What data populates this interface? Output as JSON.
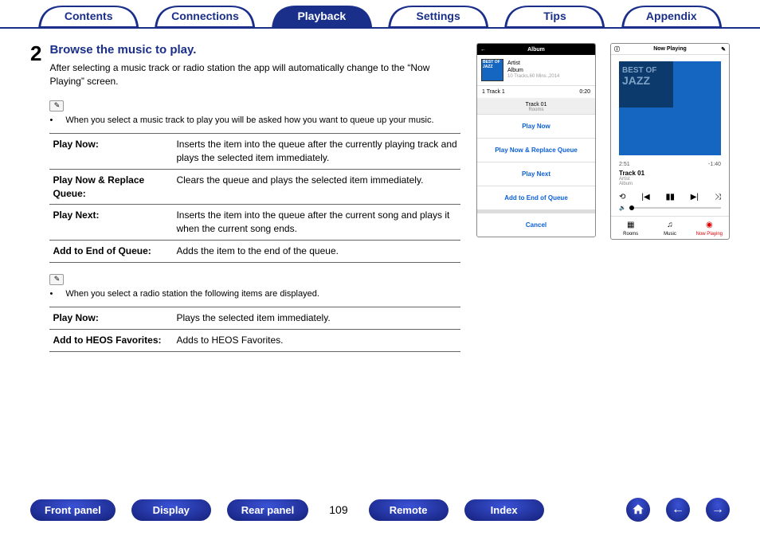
{
  "tabs": {
    "contents": "Contents",
    "connections": "Connections",
    "playback": "Playback",
    "settings": "Settings",
    "tips": "Tips",
    "appendix": "Appendix"
  },
  "step": {
    "num": "2",
    "title": "Browse the music to play.",
    "desc": "After selecting a music track or radio station the app will automatically change to the “Now Playing” screen."
  },
  "note1": "When you select a music track to play you will be asked how you want to queue up your music.",
  "table1": [
    {
      "term": "Play Now:",
      "desc": "Inserts the item into the queue after the currently playing track and plays the selected item immediately."
    },
    {
      "term": "Play Now & Replace Queue:",
      "desc": "Clears the queue and plays the selected item immediately."
    },
    {
      "term": "Play Next:",
      "desc": "Inserts the item into the queue after the current song and plays it when the current song ends."
    },
    {
      "term": "Add to End of Queue:",
      "desc": "Adds the item to the end of the queue."
    }
  ],
  "note2": "When you select a radio station the following items are displayed.",
  "table2": [
    {
      "term": "Play Now:",
      "desc": "Plays the selected item immediately."
    },
    {
      "term": "Add to HEOS Favorites:",
      "desc": "Adds to HEOS Favorites."
    }
  ],
  "phone1": {
    "bar_title": "Album",
    "back": "←",
    "thumb": "BEST OF\nJAZZ",
    "artist": "Artist",
    "album": "Album",
    "meta": "10 Tracks,60 Mins.,2014",
    "track_label": "1 Track 1",
    "track_time": "0:20",
    "sheet_title": "Track 01",
    "sheet_sub": "Rooms",
    "opt1": "Play Now",
    "opt2": "Play Now & Replace Queue",
    "opt3": "Play Next",
    "opt4": "Add to End of Queue",
    "cancel": "Cancel"
  },
  "phone2": {
    "bar_title": "Now Playing",
    "info": "ⓘ",
    "edit": "✎",
    "art1": "BEST OF",
    "art2": "JAZZ",
    "elapsed": "2:51",
    "remain": "-1:40",
    "track": "Track 01",
    "artist": "Artist",
    "album": "Album",
    "tab_rooms": "Rooms",
    "tab_music": "Music",
    "tab_now": "Now Playing"
  },
  "footer": {
    "front_panel": "Front panel",
    "display": "Display",
    "rear_panel": "Rear panel",
    "page": "109",
    "remote": "Remote",
    "index": "Index"
  }
}
